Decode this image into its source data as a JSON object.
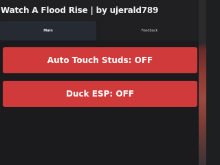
{
  "window": {
    "title": "Watch A Flood Rise | by ujerald789"
  },
  "tabs": [
    {
      "label": "Main",
      "active": true
    },
    {
      "label": "Feedback",
      "active": false
    }
  ],
  "buttons": [
    {
      "label": "Auto Touch Studs: OFF"
    },
    {
      "label": "Duck ESP: OFF"
    }
  ],
  "colors": {
    "background": "#1d1e20",
    "button_off": "#d13a3a",
    "tab_active": "#262a33",
    "text": "#ffffff"
  }
}
